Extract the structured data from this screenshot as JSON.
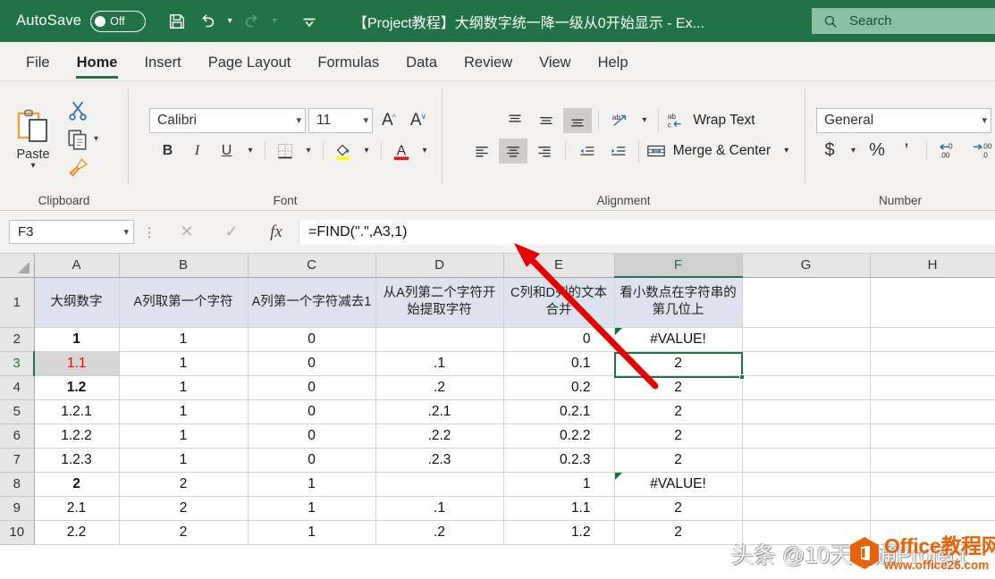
{
  "titlebar": {
    "autosave_label": "AutoSave",
    "autosave_state": "Off",
    "document_title": "【Project教程】大纲数字统一降一级从0开始显示  -  Ex...",
    "qat": [
      {
        "name": "save-icon",
        "label": "Save"
      },
      {
        "name": "undo-icon",
        "label": "Undo"
      },
      {
        "name": "redo-icon",
        "label": "Redo"
      },
      {
        "name": "customize-qat-icon",
        "label": "Customize Quick Access Toolbar"
      }
    ],
    "search": {
      "placeholder": "Search",
      "icon": "search-icon"
    },
    "accent": "#217346"
  },
  "tabs": [
    {
      "label": "File",
      "active": false
    },
    {
      "label": "Home",
      "active": true
    },
    {
      "label": "Insert",
      "active": false
    },
    {
      "label": "Page Layout",
      "active": false
    },
    {
      "label": "Formulas",
      "active": false
    },
    {
      "label": "Data",
      "active": false
    },
    {
      "label": "Review",
      "active": false
    },
    {
      "label": "View",
      "active": false
    },
    {
      "label": "Help",
      "active": false
    }
  ],
  "ribbon": {
    "clipboard": {
      "group_label": "Clipboard",
      "paste_label": "Paste",
      "cut_label": "Cut",
      "copy_label": "Copy",
      "format_painter_label": "Format Painter"
    },
    "font": {
      "group_label": "Font",
      "font_name": "Calibri",
      "font_size": "11",
      "grow_font": "A",
      "shrink_font": "A",
      "bold": "B",
      "italic": "I",
      "underline": "U",
      "borders_label": "Borders",
      "fill_color_label": "Fill Color",
      "font_color_label": "Font Color"
    },
    "alignment": {
      "group_label": "Alignment",
      "wrap_text_label": "Wrap Text",
      "merge_center_label": "Merge & Center",
      "orientation_label": "Orientation",
      "decrease_indent_label": "Decrease Indent",
      "increase_indent_label": "Increase Indent"
    },
    "number": {
      "group_label": "Number",
      "format": "General",
      "accounting": "$",
      "percent": "%",
      "comma": "’",
      "increase_decimal": "Increase Decimal",
      "decrease_decimal": "Decrease Decimal"
    }
  },
  "formula_bar": {
    "name_box": "F3",
    "cancel_icon": "close-icon",
    "enter_icon": "check-icon",
    "function_icon": "fx",
    "formula": "=FIND(\".\",A3,1)"
  },
  "grid": {
    "columns": [
      "A",
      "B",
      "C",
      "D",
      "E",
      "F",
      "G",
      "H"
    ],
    "selected_column": "F",
    "selected_row": "3",
    "active_cell": "F3",
    "row_numbers": [
      "1",
      "2",
      "3",
      "4",
      "5",
      "6",
      "7",
      "8",
      "9",
      "10"
    ],
    "rows": [
      {
        "num": "1",
        "header": true,
        "cells": [
          "大纲数字",
          "A列取第一个字符",
          "A列第一个字符减去1",
          "从A列第二个字符开始提取字符",
          "C列和D列的文本合并",
          "看小数点在字符串的第几位上",
          "",
          ""
        ]
      },
      {
        "num": "2",
        "header": false,
        "bold_a": true,
        "cells": [
          "1",
          "1",
          "0",
          "",
          "0",
          "#VALUE!",
          "",
          ""
        ],
        "error_f": true
      },
      {
        "num": "3",
        "header": false,
        "red_a": true,
        "cells": [
          "1.1",
          "1",
          "0",
          ".1",
          "0.1",
          "2",
          "",
          ""
        ]
      },
      {
        "num": "4",
        "header": false,
        "bold_a": true,
        "cells": [
          "1.2",
          "1",
          "0",
          ".2",
          "0.2",
          "2",
          "",
          ""
        ]
      },
      {
        "num": "5",
        "header": false,
        "cells": [
          "1.2.1",
          "1",
          "0",
          ".2.1",
          "0.2.1",
          "2",
          "",
          ""
        ]
      },
      {
        "num": "6",
        "header": false,
        "cells": [
          "1.2.2",
          "1",
          "0",
          ".2.2",
          "0.2.2",
          "2",
          "",
          ""
        ]
      },
      {
        "num": "7",
        "header": false,
        "cells": [
          "1.2.3",
          "1",
          "0",
          ".2.3",
          "0.2.3",
          "2",
          "",
          ""
        ]
      },
      {
        "num": "8",
        "header": false,
        "bold_a": true,
        "cells": [
          "2",
          "2",
          "1",
          "",
          "1",
          "#VALUE!",
          "",
          ""
        ],
        "error_f": true
      },
      {
        "num": "9",
        "header": false,
        "cells": [
          "2.1",
          "2",
          "1",
          ".1",
          "1.1",
          "2",
          "",
          ""
        ]
      },
      {
        "num": "10",
        "header": false,
        "cells": [
          "2.2",
          "2",
          "1",
          ".2",
          "1.2",
          "2",
          "",
          ""
        ]
      }
    ]
  },
  "annotation": {
    "arrow_color": "#e60000",
    "arrow_from": "F3 cell",
    "arrow_to": "formula bar"
  },
  "watermarks": {
    "author": "头条 @10天精通Project",
    "site_name": "Office教程网",
    "site_url": "www.office26.com",
    "logo_color": "#e8630a"
  }
}
